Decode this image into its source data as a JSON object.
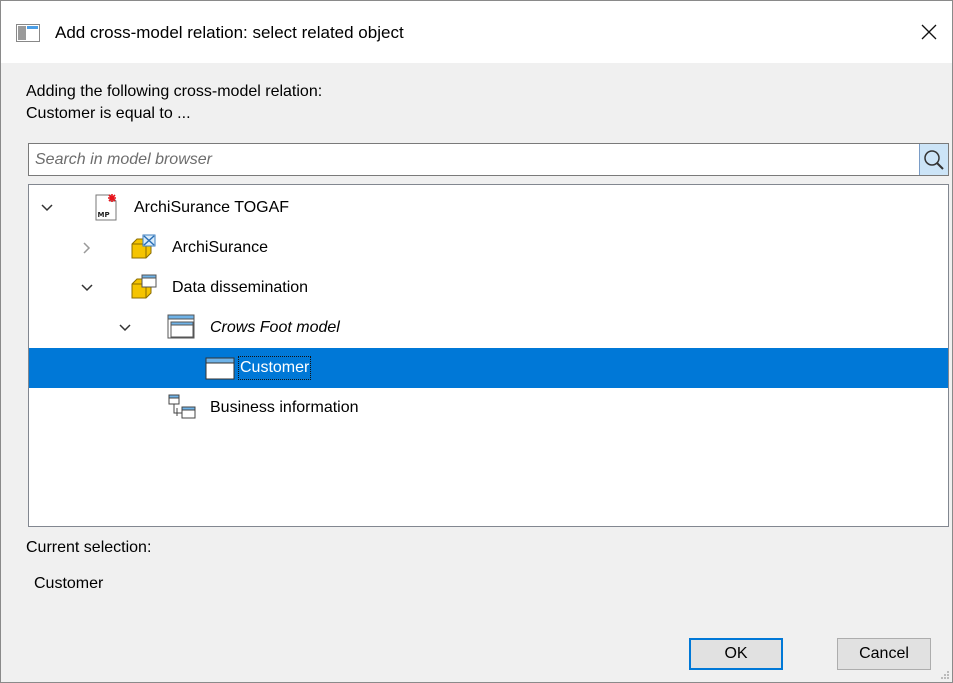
{
  "dialog": {
    "title": "Add cross-model relation: select related object",
    "close_glyph": "✕",
    "title_icon": "dialog-window-icon"
  },
  "intro": {
    "line1": "Adding the following cross-model relation:",
    "line2": "Customer is equal to ..."
  },
  "search": {
    "placeholder": "Search in model browser",
    "value": "",
    "icon": "search-icon"
  },
  "tree": {
    "items": [
      {
        "label": "ArchiSurance TOGAF",
        "expanded": true,
        "italic": false,
        "selected": false,
        "icon": "mp-model-file-icon"
      },
      {
        "label": "ArchiSurance",
        "expanded": false,
        "italic": false,
        "selected": false,
        "icon": "package-view-icon"
      },
      {
        "label": "Data dissemination",
        "expanded": true,
        "italic": false,
        "selected": false,
        "icon": "package-model-icon"
      },
      {
        "label": "Crows Foot model",
        "expanded": true,
        "italic": true,
        "selected": false,
        "icon": "data-model-icon"
      },
      {
        "label": "Customer",
        "expanded": null,
        "italic": false,
        "selected": true,
        "icon": "entity-icon"
      },
      {
        "label": "Business information",
        "expanded": null,
        "italic": false,
        "selected": false,
        "icon": "business-information-icon"
      }
    ]
  },
  "selection": {
    "label": "Current selection:",
    "value": "Customer"
  },
  "buttons": {
    "ok": "OK",
    "cancel": "Cancel"
  },
  "colors": {
    "selection": "#0078d7",
    "folder_yellow": "#f5c400",
    "search_button": "#cce4f7"
  }
}
